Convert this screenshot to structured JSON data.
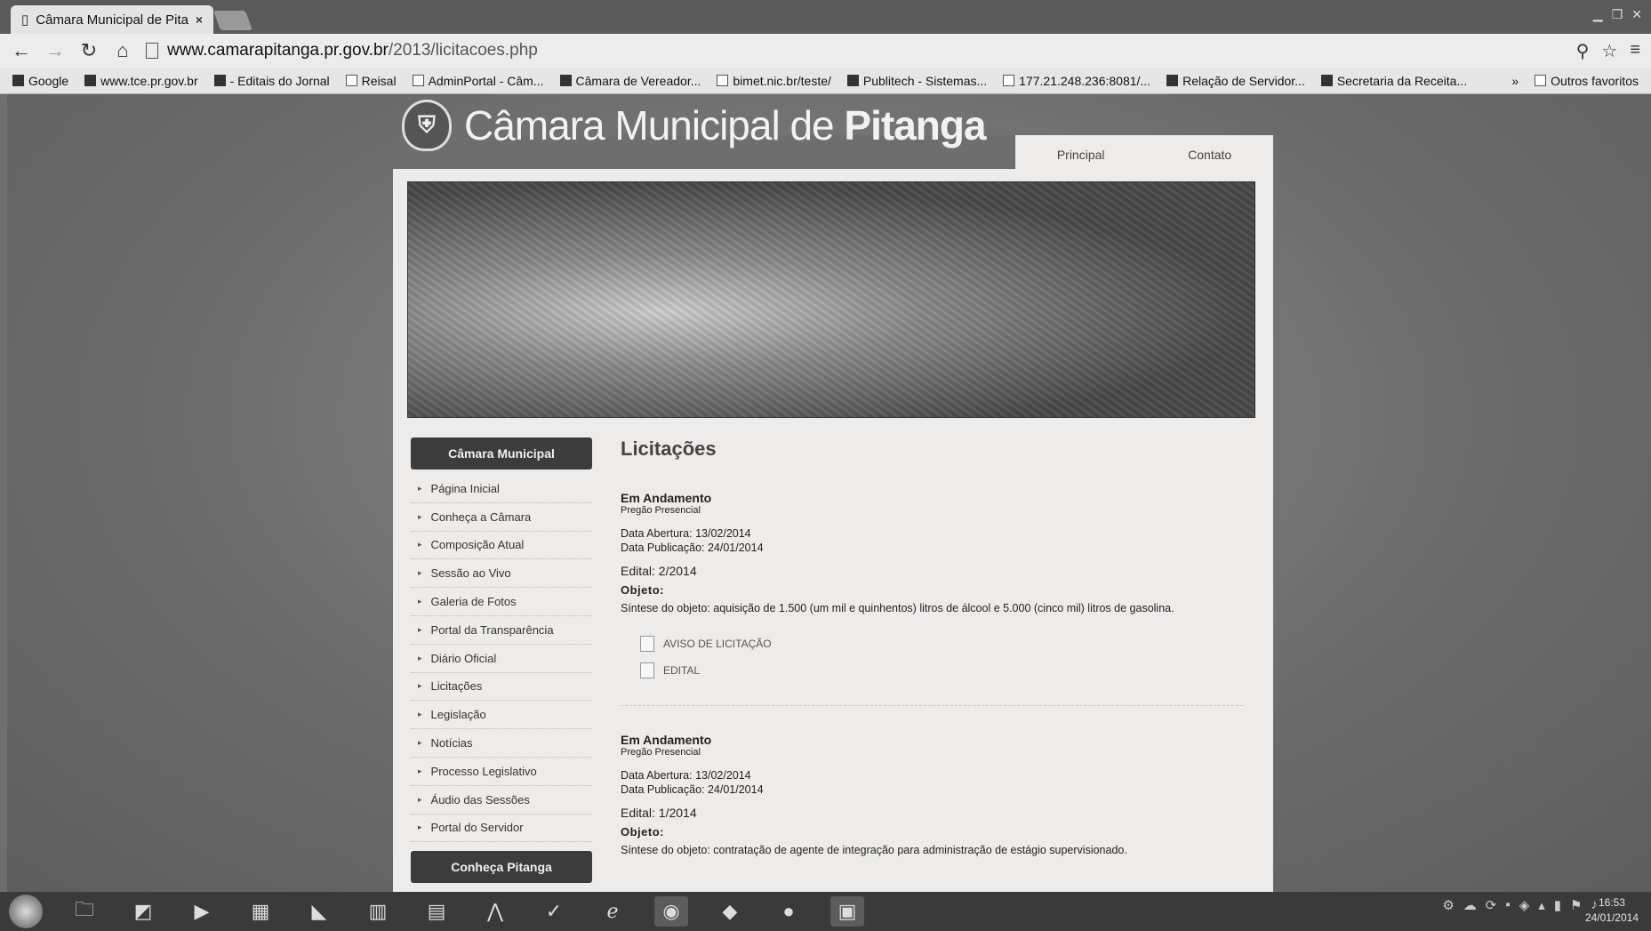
{
  "browser": {
    "tab_title": "Câmara Municipal de Pita",
    "tab_close": "×",
    "url_host": "www.camarapitanga.pr.gov.br",
    "url_path": "/2013/licitacoes.php",
    "bookmarks": [
      "Google",
      "www.tce.pr.gov.br",
      "- Editais do Jornal",
      "Reisal",
      "AdminPortal - Câm...",
      "Câmara de Vereador...",
      "bimet.nic.br/teste/",
      "Publitech - Sistemas...",
      "177.21.248.236:8081/...",
      "Relação de Servidor...",
      "Secretaria da Receita..."
    ],
    "bookmarks_overflow": "»",
    "other_bookmarks": "Outros favoritos"
  },
  "site": {
    "title_regular": "Câmara Municipal de ",
    "title_bold": "Pitanga",
    "top_nav": [
      "Principal",
      "Contato"
    ],
    "sidebar_header": "Câmara Municipal",
    "sidebar_items": [
      "Página Inicial",
      "Conheça a Câmara",
      "Composição Atual",
      "Sessão ao Vivo",
      "Galeria de Fotos",
      "Portal da Transparência",
      "Diário Oficial",
      "Licitações",
      "Legislação",
      "Notícias",
      "Processo Legislativo",
      "Áudio das Sessões",
      "Portal do Servidor"
    ],
    "sidebar_footer": "Conheça Pitanga",
    "page_heading": "Licitações",
    "entries": [
      {
        "status": "Em Andamento",
        "type": "Pregão Presencial",
        "opening": "Data Abertura: 13/02/2014",
        "publication": "Data Publicação: 24/01/2014",
        "edital": "Edital: 2/2014",
        "object_label": "Objeto:",
        "object_text": "Síntese do objeto: aquisição de 1.500 (um mil e quinhentos) litros de álcool e 5.000 (cinco mil) litros de gasolina.",
        "docs": [
          "AVISO DE LICITAÇÃO",
          "EDITAL"
        ]
      },
      {
        "status": "Em Andamento",
        "type": "Pregão Presencial",
        "opening": "Data Abertura: 13/02/2014",
        "publication": "Data Publicação: 24/01/2014",
        "edital": "Edital: 1/2014",
        "object_label": "Objeto:",
        "object_text": "Síntese do objeto: contratação de agente de integração para administração de estágio supervisionado."
      }
    ]
  },
  "taskbar": {
    "time": "16:53",
    "date": "24/01/2014"
  }
}
